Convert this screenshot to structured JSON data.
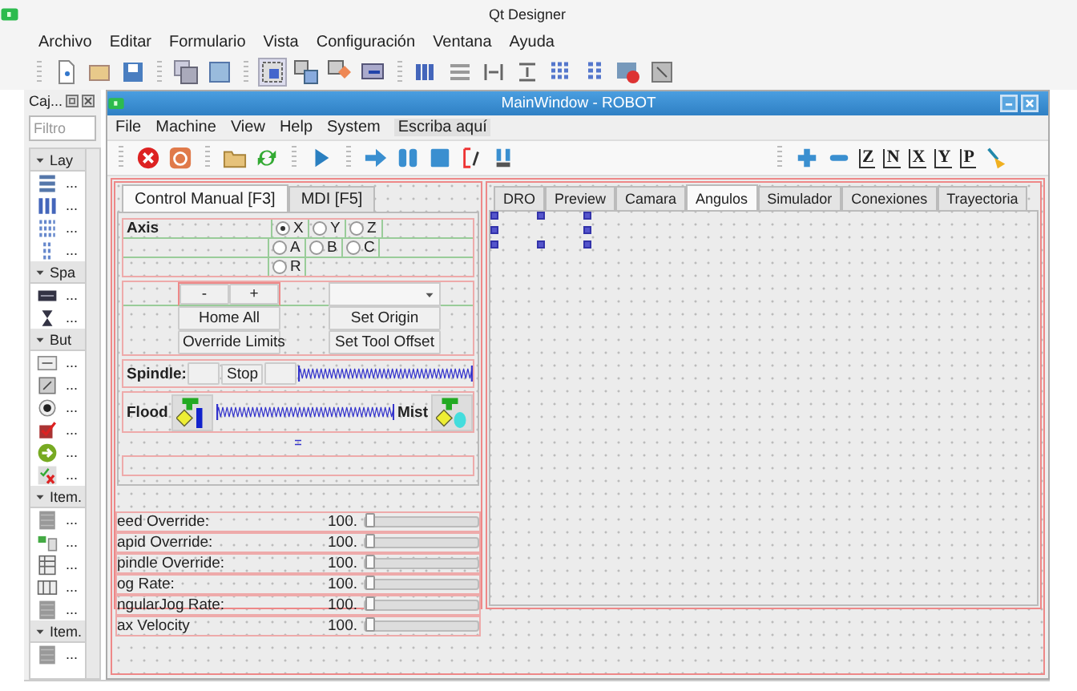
{
  "app": {
    "title": "Qt Designer"
  },
  "menu": [
    "Archivo",
    "Editar",
    "Formulario",
    "Vista",
    "Configuración",
    "Ventana",
    "Ayuda"
  ],
  "widget_box": {
    "title": "Caj...",
    "filter": {
      "placeholder": "Filtro"
    },
    "categories": [
      {
        "label": "Lay",
        "expanded": true,
        "items": [
          "...",
          "...",
          "...",
          "..."
        ]
      },
      {
        "label": "Spa",
        "expanded": true,
        "items": [
          "...",
          "..."
        ]
      },
      {
        "label": "But",
        "expanded": true,
        "items": [
          "...",
          "...",
          "...",
          "...",
          "...",
          "..."
        ]
      },
      {
        "label": "Item.",
        "expanded": true,
        "items": [
          "...",
          "...",
          "...",
          "...",
          "..."
        ]
      },
      {
        "label": "Item.",
        "expanded": true,
        "items": [
          "..."
        ]
      }
    ]
  },
  "form_window": {
    "title": "MainWindow - ROBOT",
    "menu": [
      {
        "label": "File",
        "kind": "menu"
      },
      {
        "label": "Machine",
        "kind": "menu"
      },
      {
        "label": "View",
        "kind": "menu"
      },
      {
        "label": "Help",
        "kind": "menu"
      },
      {
        "label": "System",
        "kind": "menu"
      },
      {
        "label": "Escriba aquí",
        "kind": "placeholder"
      }
    ],
    "view_buttons": [
      "Z",
      "N",
      "X",
      "Y",
      "P"
    ],
    "left_tabs": [
      {
        "label": "Control Manual [F3]",
        "selected": true
      },
      {
        "label": "MDI [F5]",
        "selected": false
      }
    ],
    "axis": {
      "label": "Axis",
      "rows": [
        {
          "options": [
            {
              "label": "X",
              "selected": true
            },
            {
              "label": "Y",
              "selected": false
            },
            {
              "label": "Z",
              "selected": false
            }
          ]
        },
        {
          "options": [
            {
              "label": "A",
              "selected": false
            },
            {
              "label": "B",
              "selected": false
            },
            {
              "label": "C",
              "selected": false
            }
          ]
        },
        {
          "options": [
            {
              "label": "R",
              "selected": false
            }
          ]
        }
      ]
    },
    "jog": {
      "minus": "-",
      "plus": "+",
      "home_all": "Home All",
      "override_limits": "Override Limits",
      "set_origin": "Set Origin",
      "set_tool_offset": "Set Tool Offset"
    },
    "spindle": {
      "label": "Spindle:",
      "buttons": [
        {
          "kind": "blank"
        },
        {
          "kind": "text",
          "label": "Stop"
        },
        {
          "kind": "blank"
        }
      ]
    },
    "coolant": {
      "flood": "Flood",
      "mist": "Mist"
    },
    "overrides": [
      {
        "label": "eed Override:",
        "value": "100.",
        "level": 0
      },
      {
        "label": "apid Override:",
        "value": "100.",
        "level": 0
      },
      {
        "label": "pindle Override:",
        "value": "100.",
        "level": 0
      },
      {
        "label": "og Rate:",
        "value": "100.",
        "level": 0
      },
      {
        "label": "ngularJog Rate:",
        "value": "100.",
        "level": 0
      },
      {
        "label": "ax Velocity",
        "value": "100.",
        "level": 0
      }
    ],
    "right_tabs": [
      {
        "label": "DRO",
        "selected": false
      },
      {
        "label": "Preview",
        "selected": false
      },
      {
        "label": "Camara",
        "selected": false
      },
      {
        "label": "Angulos",
        "selected": true
      },
      {
        "label": "Simulador",
        "selected": false
      },
      {
        "label": "Conexiones",
        "selected": false
      },
      {
        "label": "Trayectoria",
        "selected": false
      }
    ]
  }
}
